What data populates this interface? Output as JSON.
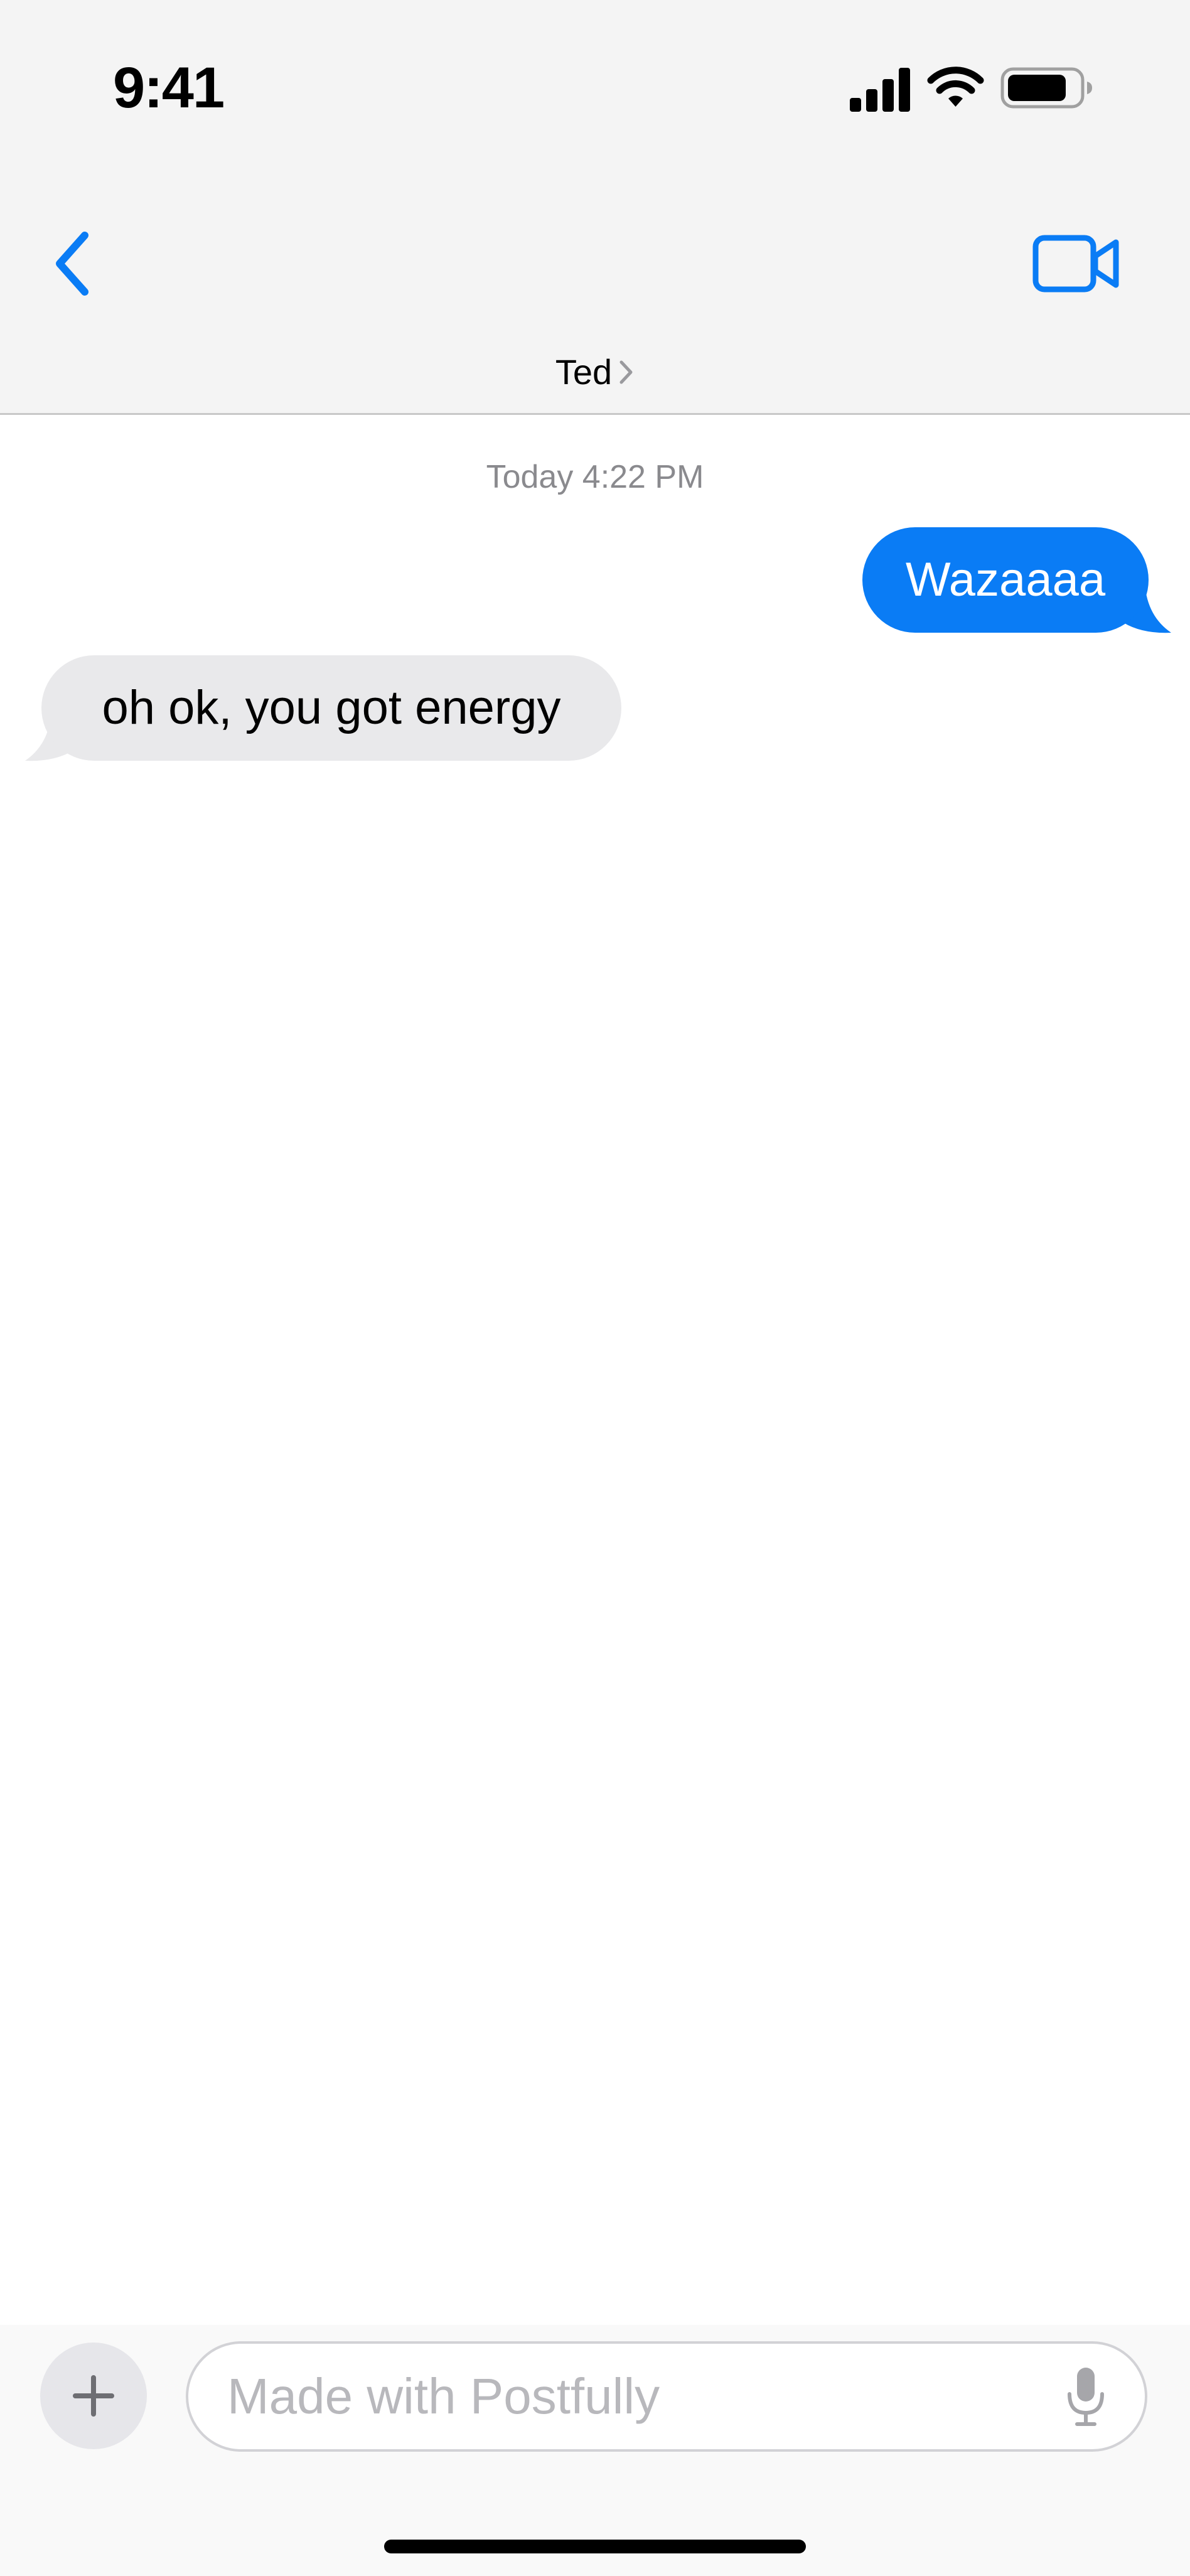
{
  "status_bar": {
    "time": "9:41",
    "icons": [
      "cellular-signal-icon",
      "wifi-icon",
      "battery-icon"
    ]
  },
  "header": {
    "back_icon": "chevron-left-icon",
    "contact_name": "Ted",
    "contact_chevron_icon": "chevron-right-icon",
    "video_icon": "video-camera-icon"
  },
  "conversation": {
    "timestamp": "Today 4:22 PM",
    "messages": [
      {
        "direction": "sent",
        "text": "Wazaaaa"
      },
      {
        "direction": "received",
        "text": "oh ok, you got energy"
      }
    ]
  },
  "composer": {
    "plus_icon": "plus-icon",
    "placeholder": "Made with Postfully",
    "value": "",
    "mic_icon": "microphone-icon"
  },
  "colors": {
    "accent": "#0a7cf5",
    "sent_bubble": "#0a7cf5",
    "received_bubble": "#e9e9eb",
    "header_bg": "#f4f4f4",
    "timestamp_text": "#8a8a8e",
    "placeholder_text": "#b8b8bc"
  }
}
